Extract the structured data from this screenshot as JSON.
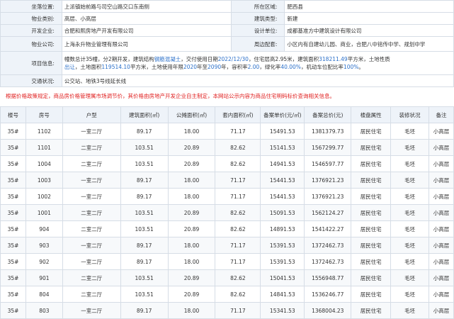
{
  "info": {
    "location_label": "坐落位置:",
    "location_value": "上派镇始前路与司空山路交口东南侧",
    "district_label": "所在区域:",
    "district_value": "肥西县",
    "category_label": "物业类别:",
    "category_value": "高层、小高层",
    "building_type_label": "建筑类型:",
    "building_type_value": "新建",
    "developer_label": "开发企业:",
    "developer_value": "合肥和熙房地产开发有限公司",
    "designer_label": "设计单位:",
    "designer_value": "成都基准方中建筑设计有限公司",
    "property_label": "物业公司:",
    "property_value": "上海永升物业管理有限公司",
    "surroundings_label": "周边配套:",
    "surroundings_value": "小区内有自建幼儿园、商业，合肥八中铭传中学、规划中学",
    "project_label": "项目信息:",
    "project_t1": "幢数总计35幢，分2期开发，建筑结构",
    "project_h1": "钢筋混凝土",
    "project_t2": "，交付使用日期",
    "project_h2": "2022/12/30",
    "project_t3": "，住宅层高2.95米，建筑面积",
    "project_h3": "318211.49",
    "project_t4": "平方米，土地性质",
    "project_h4": "出让",
    "project_t5": "，土地面积",
    "project_h5": "119514.10",
    "project_t6": "平方米，土地使用年限",
    "project_h6": "2020",
    "project_t7": "年至",
    "project_h7": "2090",
    "project_t8": "年，容积率",
    "project_h8": "2.00",
    "project_t9": "，绿化率",
    "project_h9": "40.00%",
    "project_t10": "，机动车位配比率",
    "project_h10": "100%",
    "project_t11": "。",
    "traffic_label": "交通状况:",
    "traffic_value": "公交站、地铁3号线延长线"
  },
  "notice": "根据价格政策规定，商品房价格管理属市场调节价，其价格由房地产开发企业自主制定，本网站公示内容为商品住宅明码标价查询相关信息。",
  "table": {
    "headers": [
      "楼号",
      "房号",
      "户型",
      "建筑面积(㎡)",
      "公摊面积(㎡)",
      "套内面积(㎡)",
      "备案单价(元/㎡)",
      "备案总价(元)",
      "楼盘属性",
      "装修状况",
      "备注"
    ],
    "rows": [
      [
        "35#",
        "1102",
        "一室二厅",
        "89.17",
        "18.00",
        "71.17",
        "15491.53",
        "1381379.73",
        "居民住宅",
        "毛坯",
        "小高层"
      ],
      [
        "35#",
        "1101",
        "二室二厅",
        "103.51",
        "20.89",
        "82.62",
        "15141.53",
        "1567299.77",
        "居民住宅",
        "毛坯",
        "小高层"
      ],
      [
        "35#",
        "1004",
        "二室二厅",
        "103.51",
        "20.89",
        "82.62",
        "14941.53",
        "1546597.77",
        "居民住宅",
        "毛坯",
        "小高层"
      ],
      [
        "35#",
        "1003",
        "一室二厅",
        "89.17",
        "18.00",
        "71.17",
        "15441.53",
        "1376921.23",
        "居民住宅",
        "毛坯",
        "小高层"
      ],
      [
        "35#",
        "1002",
        "一室二厅",
        "89.17",
        "18.00",
        "71.17",
        "15441.53",
        "1376921.23",
        "居民住宅",
        "毛坯",
        "小高层"
      ],
      [
        "35#",
        "1001",
        "二室二厅",
        "103.51",
        "20.89",
        "82.62",
        "15091.53",
        "1562124.27",
        "居民住宅",
        "毛坯",
        "小高层"
      ],
      [
        "35#",
        "904",
        "二室二厅",
        "103.51",
        "20.89",
        "82.62",
        "14891.53",
        "1541422.27",
        "居民住宅",
        "毛坯",
        "小高层"
      ],
      [
        "35#",
        "903",
        "一室二厅",
        "89.17",
        "18.00",
        "71.17",
        "15391.53",
        "1372462.73",
        "居民住宅",
        "毛坯",
        "小高层"
      ],
      [
        "35#",
        "902",
        "一室二厅",
        "89.17",
        "18.00",
        "71.17",
        "15391.53",
        "1372462.73",
        "居民住宅",
        "毛坯",
        "小高层"
      ],
      [
        "35#",
        "901",
        "二室二厅",
        "103.51",
        "20.89",
        "82.62",
        "15041.53",
        "1556948.77",
        "居民住宅",
        "毛坯",
        "小高层"
      ],
      [
        "35#",
        "804",
        "二室二厅",
        "103.51",
        "20.89",
        "82.62",
        "14841.53",
        "1536246.77",
        "居民住宅",
        "毛坯",
        "小高层"
      ],
      [
        "35#",
        "803",
        "一室二厅",
        "89.17",
        "18.00",
        "71.17",
        "15341.53",
        "1368004.23",
        "居民住宅",
        "毛坯",
        "小高层"
      ]
    ]
  }
}
